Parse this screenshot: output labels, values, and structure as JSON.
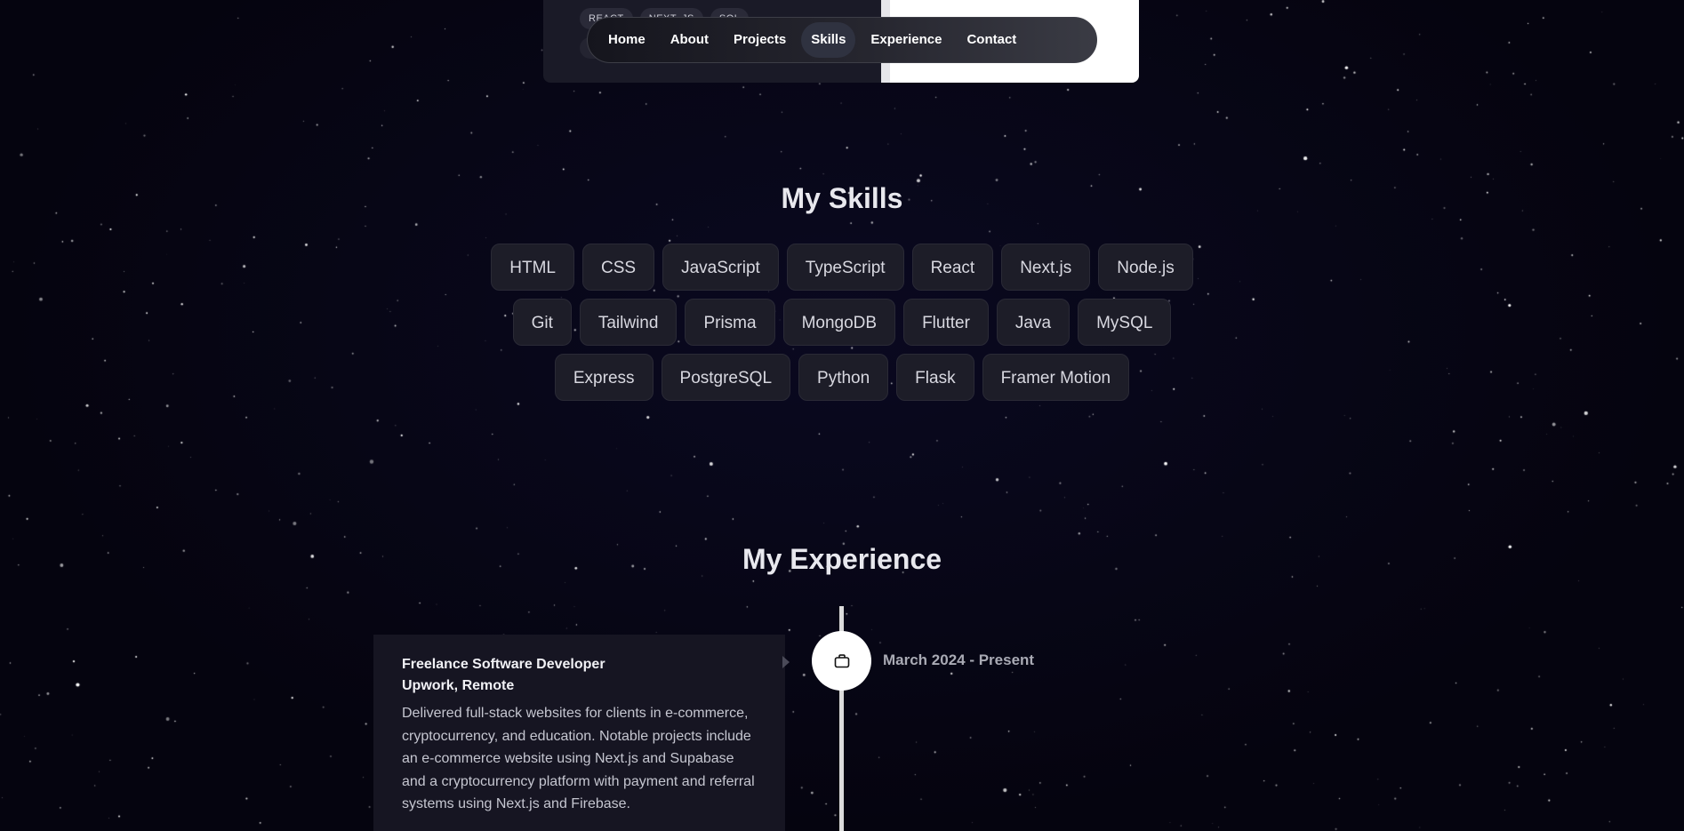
{
  "project": {
    "tags": [
      "REACT",
      "NEXT. JS",
      "SQL"
    ]
  },
  "nav": {
    "items": [
      {
        "label": "Home",
        "active": false
      },
      {
        "label": "About",
        "active": false
      },
      {
        "label": "Projects",
        "active": false
      },
      {
        "label": "Skills",
        "active": true
      },
      {
        "label": "Experience",
        "active": false
      },
      {
        "label": "Contact",
        "active": false
      }
    ]
  },
  "skills": {
    "title": "My Skills",
    "rows": [
      [
        "HTML",
        "CSS",
        "JavaScript",
        "TypeScript",
        "React",
        "Next.js",
        "Node.js"
      ],
      [
        "Git",
        "Tailwind",
        "Prisma",
        "MongoDB",
        "Flutter",
        "Java",
        "MySQL"
      ],
      [
        "Express",
        "PostgreSQL",
        "Python",
        "Flask",
        "Framer Motion"
      ]
    ]
  },
  "experience": {
    "title": "My Experience",
    "items": [
      {
        "role": "Freelance Software Developer",
        "company": "Upwork, Remote",
        "description": "Delivered full-stack websites for clients in e-commerce, cryptocurrency, and education. Notable projects include an e-commerce website using Next.js and Supabase and a cryptocurrency platform with payment and referral systems using Next.js and Firebase.",
        "date": "March 2024 - Present",
        "icon": "briefcase-icon"
      }
    ]
  },
  "colors": {
    "background": "#05040f",
    "card": "#1d1d28",
    "accent": "#ffffff"
  }
}
